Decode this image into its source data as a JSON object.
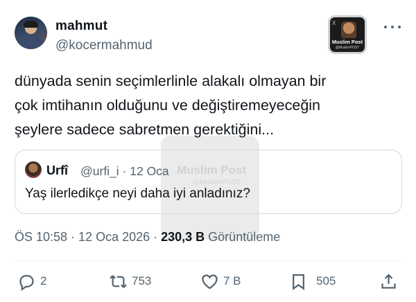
{
  "author": {
    "name": "mahmut",
    "handle": "@kocermahmud"
  },
  "badge": {
    "x_label": "X",
    "title": "Muslim Post",
    "subtitle": "@MuslimPOST"
  },
  "tweet": {
    "lines": [
      "dünyada senin seçimlerlinle alakalı olmayan bir",
      "çok imtihanın olduğunu ve değiştiremeyeceğin",
      "şeylere sadece sabretmen gerektiğini..."
    ]
  },
  "quote": {
    "name": "Urfî",
    "handle": "@urfi_i · 12 Oca",
    "text": "Yaş ilerledikçe neyi daha iyi anladınız?"
  },
  "watermark": {
    "title": "Muslim Post",
    "subtitle": "@MuslimPOST"
  },
  "meta": {
    "time_date": "ÖS 10:58 · 12 Oca 2026 · ",
    "views": "230,3 B",
    "views_label": " Görüntüleme"
  },
  "actions": {
    "replies": "2",
    "reposts": "753",
    "likes": "7 B",
    "bookmarks": "505"
  },
  "icons": {
    "reply": "reply-icon",
    "repost": "repost-icon",
    "like": "heart-icon",
    "bookmark": "bookmark-icon",
    "share": "share-icon",
    "more": "more-dots-icon"
  },
  "colors": {
    "text": "#0f1419",
    "secondary": "#536471",
    "border": "#cfd9de"
  }
}
